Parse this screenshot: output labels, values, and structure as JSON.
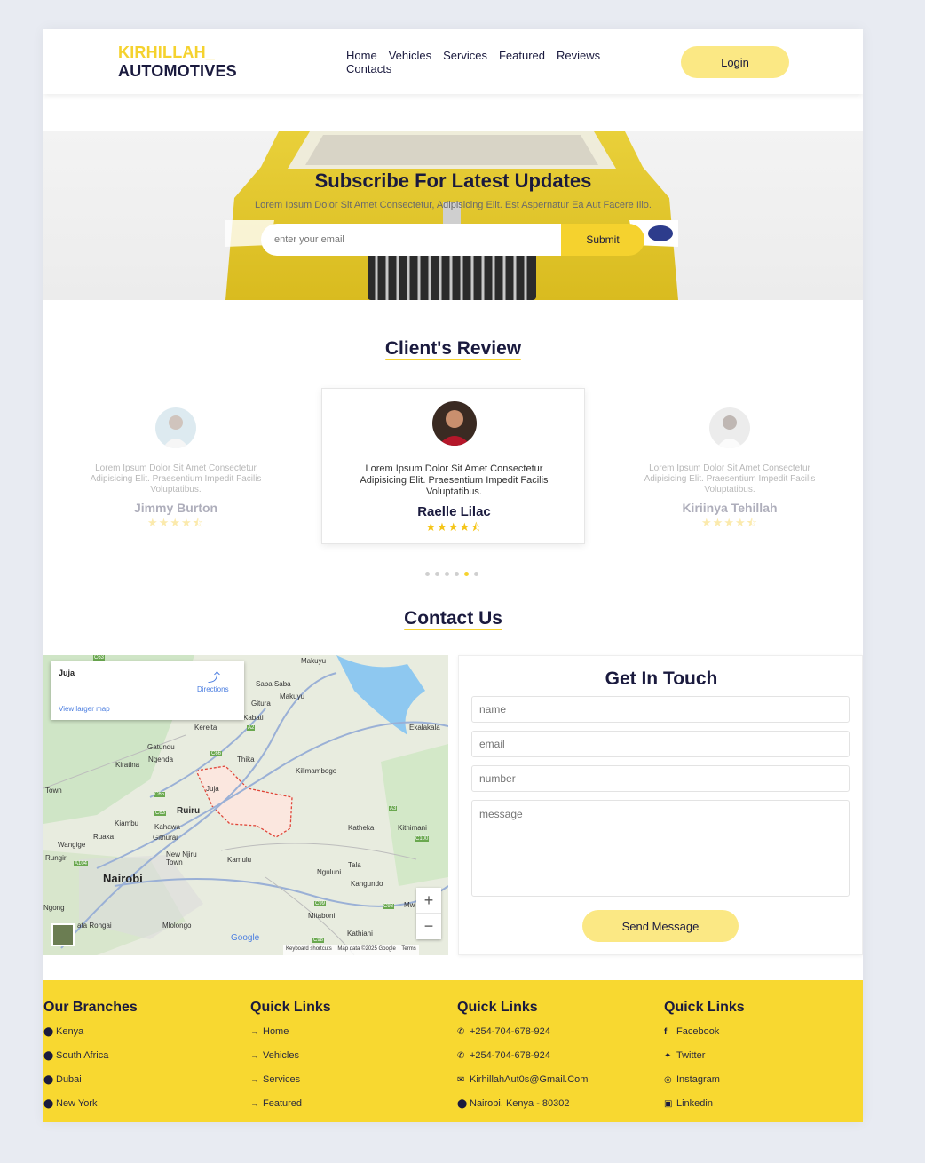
{
  "header": {
    "logo_line1": "KIRHILLAH_",
    "logo_line2": "AUTOMOTIVES",
    "nav": [
      "Home",
      "Vehicles",
      "Services",
      "Featured",
      "Reviews",
      "Contacts"
    ],
    "login_label": "Login"
  },
  "hero": {
    "title": "Subscribe For Latest Updates",
    "subtitle": "Lorem Ipsum Dolor Sit Amet Consectetur, Adipisicing Elit. Est Aspernatur Ea Aut Facere Illo.",
    "email_placeholder": "enter your email",
    "submit_label": "Submit"
  },
  "reviews": {
    "title": "Client's Review",
    "items": [
      {
        "text": "Lorem Ipsum Dolor Sit Amet Consectetur Adipisicing Elit. Praesentium Impedit Facilis Voluptatibus.",
        "name": "Jimmy Burton",
        "stars": "★★★★⯪"
      },
      {
        "text": "Lorem Ipsum Dolor Sit Amet Consectetur Adipisicing Elit. Praesentium Impedit Facilis Voluptatibus.",
        "name": "Raelle Lilac",
        "stars": "★★★★⯪"
      },
      {
        "text": "Lorem Ipsum Dolor Sit Amet Consectetur Adipisicing Elit. Praesentium Impedit Facilis Voluptatibus.",
        "name": "Kiriinya Tehillah",
        "stars": "★★★★⯪"
      }
    ],
    "dots": 6,
    "active_dot": 4
  },
  "contact": {
    "title": "Contact Us",
    "map": {
      "place": "Juja",
      "directions": "Directions",
      "larger_map": "View larger map",
      "city": "Nairobi",
      "labels": [
        "Makuyu",
        "Saba Saba",
        "Makuyu",
        "Gitura",
        "Kabati",
        "Kereita",
        "Ekalakala",
        "Gatundu",
        "Ngenda",
        "Thika",
        "Kiratina",
        "Kilimambogo",
        "Juja",
        "Town",
        "Ruiru",
        "Kiambu",
        "Kahawa",
        "Githurai",
        "Ruaka",
        "Wangige",
        "Rungiri",
        "New Njiru Town",
        "Kamulu",
        "Katheka",
        "Kithimani",
        "Ngong",
        "Nguluni",
        "Tala",
        "Kangundo",
        "Mitaboni",
        "ata Rongai",
        "Mlolongo",
        "Kathiani",
        "Mw",
        "Google"
      ],
      "road_labels": [
        "C63",
        "A2",
        "C66",
        "C65",
        "C63",
        "A3",
        "C100",
        "A104",
        "C98",
        "C99",
        "C98"
      ],
      "footer": [
        "Keyboard shortcuts",
        "Map data ©2025 Google",
        "Terms"
      ],
      "zoom_in": "+",
      "zoom_out": "−"
    },
    "form_title": "Get In Touch",
    "name_placeholder": "name",
    "email_placeholder": "email",
    "number_placeholder": "number",
    "message_placeholder": "message",
    "send_label": "Send Message"
  },
  "footer": {
    "columns": [
      {
        "title": "Our Branches",
        "icon": "map-marker-icon",
        "items": [
          "Kenya",
          "South Africa",
          "Dubai",
          "New York"
        ]
      },
      {
        "title": "Quick Links",
        "icon": "arrow-right-icon",
        "items": [
          "Home",
          "Vehicles",
          "Services",
          "Featured"
        ]
      },
      {
        "title": "Quick Links",
        "items": [
          "+254-704-678-924",
          "+254-704-678-924",
          "KirhillahAut0s@Gmail.Com",
          "Nairobi, Kenya - 80302"
        ],
        "icons": [
          "phone-icon",
          "phone-icon",
          "envelope-icon",
          "map-marker-icon"
        ]
      },
      {
        "title": "Quick Links",
        "items": [
          "Facebook",
          "Twitter",
          "Instagram",
          "Linkedin"
        ],
        "icons": [
          "facebook-icon",
          "twitter-icon",
          "instagram-icon",
          "linkedin-icon"
        ]
      }
    ]
  },
  "colors": {
    "accent": "#f5d22e",
    "accent_light": "#fbe884",
    "navy": "#1a1a3e",
    "footer_bg": "#f8d830",
    "page_bg": "#e8ebf2"
  }
}
